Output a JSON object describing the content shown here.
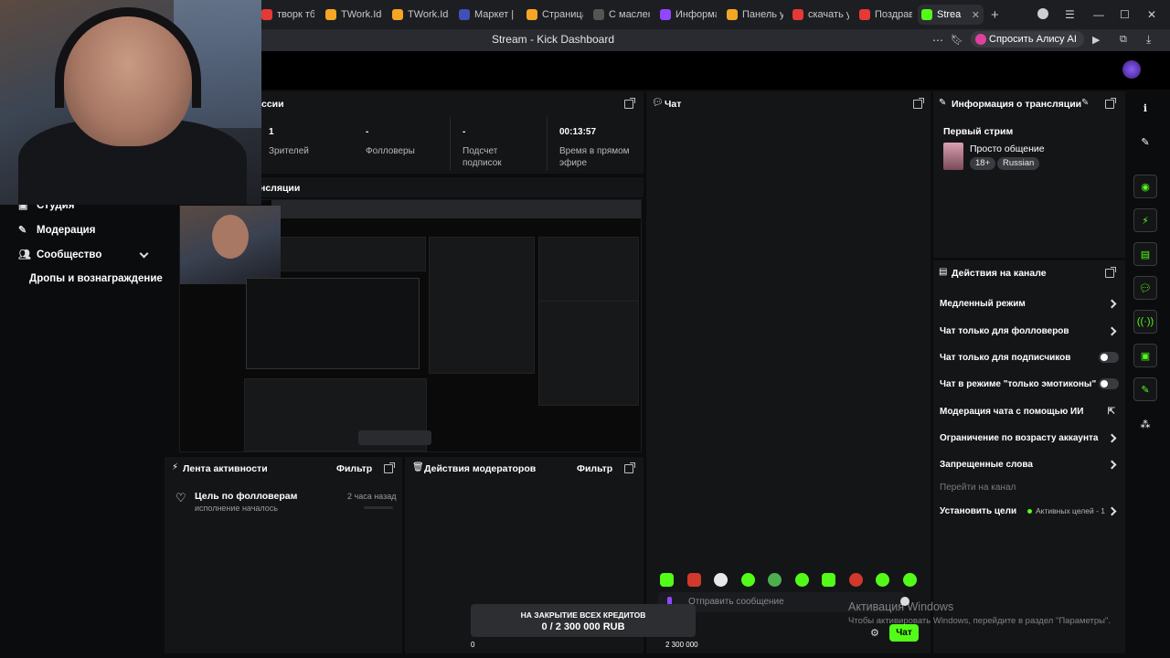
{
  "browser": {
    "tabs": [
      {
        "label": "творк тба",
        "color": "#e53935"
      },
      {
        "label": "TWork.Ide",
        "color": "#f5a623"
      },
      {
        "label": "TWork.Ide",
        "color": "#f5a623"
      },
      {
        "label": "Маркет | Y",
        "color": "#3f51b5"
      },
      {
        "label": "Страница",
        "color": "#f5a623"
      },
      {
        "label": "С маслене",
        "color": "#444"
      },
      {
        "label": "Информа",
        "color": "#9146ff"
      },
      {
        "label": "Панель уп",
        "color": "#f5a623"
      },
      {
        "label": "скачать ур",
        "color": "#e53935"
      },
      {
        "label": "Поздравл",
        "color": "#e53935"
      },
      {
        "label": "Strea",
        "color": "#53fc18"
      }
    ],
    "page_title": "Stream - Kick Dashboard",
    "alice_label": "Спросить Алису AI"
  },
  "session": {
    "title_fragment": "ссии",
    "stats": [
      {
        "value": "1",
        "label": "Зрителей"
      },
      {
        "value": "-",
        "label": "Фолловеры"
      },
      {
        "value": "-",
        "label": "Подсчет подписок"
      },
      {
        "value": "00:13:57",
        "label": "Время в прямом эфире"
      }
    ],
    "preview_title_fragment": "нсляции"
  },
  "nav": {
    "studio": "Студия",
    "moderation": "Модерация",
    "community": "Сообщество",
    "drops": "Дропы и вознаграждение"
  },
  "chat": {
    "title": "Чат",
    "input_placeholder": "Отправить сообщение",
    "send_label": "Чат"
  },
  "stream_info": {
    "title": "Информация о трансляции",
    "stream_name": "Первый стрим",
    "category": "Просто общение",
    "tags": [
      "18+",
      "Russian"
    ]
  },
  "channel_actions": {
    "title": "Действия на канале",
    "items": [
      {
        "label": "Медленный режим",
        "control": "chevron"
      },
      {
        "label": "Чат только для фолловеров",
        "control": "chevron"
      },
      {
        "label": "Чат только для подписчиков",
        "control": "toggle"
      },
      {
        "label": "Чат в режиме \"только эмотиконы\"",
        "control": "toggle"
      },
      {
        "label": "Модерация чата с помощью ИИ",
        "control": "external"
      },
      {
        "label": "Ограничение по возрасту аккаунта",
        "control": "chevron"
      },
      {
        "label": "Запрещенные слова",
        "control": "chevron"
      }
    ],
    "go_to_channel": "Перейти на канал",
    "set_goals": "Установить цели",
    "active_goals": "Активных целей - 1"
  },
  "activity": {
    "title": "Лента активности",
    "filter": "Фильтр",
    "item_title": "Цель по фолловерам",
    "item_sub": "исполнение началось",
    "item_time": "2 часа назад"
  },
  "mod_actions": {
    "title": "Действия модераторов",
    "filter": "Фильтр"
  },
  "goal_widget": {
    "title": "НА ЗАКРЫТИЕ ВСЕХ КРЕДИТОВ",
    "amount": "0 / 2 300 000 RUB",
    "min": "0",
    "max": "2 300 000",
    "progress": 0
  },
  "windows_watermark": {
    "title": "Активация Windows",
    "subtitle": "Чтобы активировать Windows, перейдите в раздел \"Параметры\"."
  },
  "colors": {
    "accent": "#53fc18",
    "panel": "#141517",
    "background": "#0b0c0e"
  }
}
